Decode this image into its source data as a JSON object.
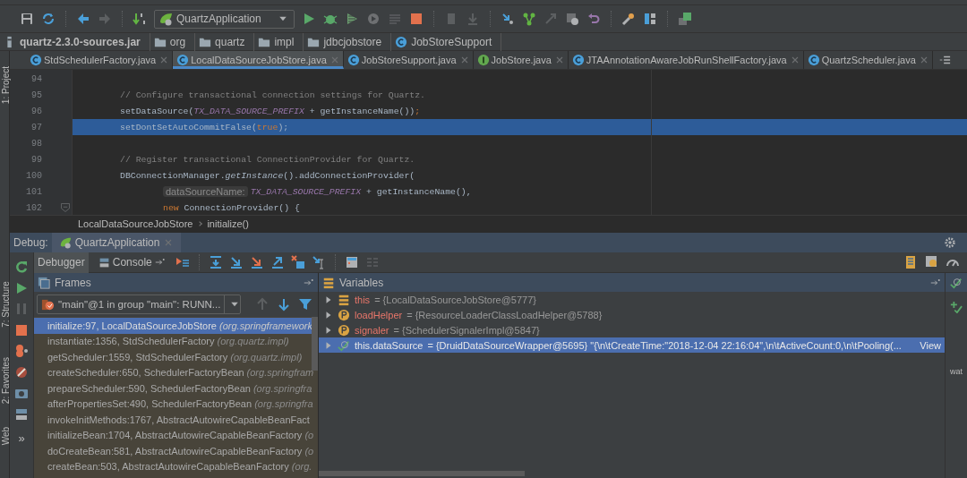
{
  "toolbar": {
    "run_config": "QuartzApplication"
  },
  "nav_bar": [
    "quartz-2.3.0-sources.jar",
    "org",
    "quartz",
    "impl",
    "jdbcjobstore",
    "JobStoreSupport"
  ],
  "side_labels": [
    "1: Project",
    "7: Structure",
    "2: Favorites",
    "Web"
  ],
  "tabs": [
    {
      "label": "StdSchedulerFactory.java",
      "selected": false,
      "kind": "class"
    },
    {
      "label": "LocalDataSourceJobStore.java",
      "selected": true,
      "kind": "class"
    },
    {
      "label": "JobStoreSupport.java",
      "selected": false,
      "kind": "class"
    },
    {
      "label": "JobStore.java",
      "selected": false,
      "kind": "interface"
    },
    {
      "label": "JTAAnnotationAwareJobRunShellFactory.java",
      "selected": false,
      "kind": "class"
    },
    {
      "label": "QuartzScheduler.java",
      "selected": false,
      "kind": "class"
    }
  ],
  "editor": {
    "lines": [
      {
        "number": "94",
        "current": false
      },
      {
        "number": "95",
        "current": false,
        "continuation": false,
        "segments": [
          {
            "kind": "comment",
            "text": "// Configure transactional connection settings for Quartz."
          }
        ]
      },
      {
        "number": "96",
        "current": false,
        "continuation": false,
        "segments": [
          {
            "kind": "plain",
            "text": "setDataSource("
          },
          {
            "kind": "constant",
            "text": "TX_DATA_SOURCE_PREFIX"
          },
          {
            "kind": "plain",
            "text": " + getInstanceName())"
          },
          {
            "kind": "keyword",
            "text": ";"
          }
        ]
      },
      {
        "number": "97",
        "current": true,
        "continuation": false,
        "segments": [
          {
            "kind": "plain",
            "text": "setDontSetAutoCommitFalse("
          },
          {
            "kind": "keyword",
            "text": "true"
          },
          {
            "kind": "plain",
            "text": ");"
          }
        ]
      },
      {
        "number": "98",
        "current": false
      },
      {
        "number": "99",
        "current": false,
        "continuation": false,
        "segments": [
          {
            "kind": "comment",
            "text": "// Register transactional ConnectionProvider for Quartz."
          }
        ]
      },
      {
        "number": "100",
        "current": false,
        "continuation": false,
        "segments": [
          {
            "kind": "plain",
            "text": "DBConnectionManager."
          },
          {
            "kind": "static",
            "text": "getInstance"
          },
          {
            "kind": "plain",
            "text": "().addConnectionProvider("
          }
        ]
      },
      {
        "number": "101",
        "current": false,
        "continuation": true,
        "segments": [
          {
            "kind": "hint",
            "text": "dataSourceName:"
          },
          {
            "kind": "constant",
            "text": "TX_DATA_SOURCE_PREFIX"
          },
          {
            "kind": "plain",
            "text": " + getInstanceName(),"
          }
        ]
      },
      {
        "number": "102",
        "current": false,
        "continuation": true,
        "segments": [
          {
            "kind": "keyword",
            "text": "new"
          },
          {
            "kind": "plain",
            "text": " ConnectionProvider() {"
          }
        ]
      }
    ],
    "breadcrumbs": [
      "LocalDataSourceJobStore",
      "initialize()"
    ]
  },
  "debug": {
    "label": "Debug:",
    "session_tab": "QuartzApplication",
    "tabs": [
      {
        "label": "Debugger",
        "selected": true
      },
      {
        "label": "Console",
        "selected": false
      }
    ],
    "more_label": "»",
    "frames": {
      "title": "Frames",
      "thread": "\"main\"@1 in group \"main\": RUNN...",
      "items": [
        {
          "method": "initialize:97, LocalDataSourceJobStore",
          "package": "(org.springframework",
          "selected": true
        },
        {
          "method": "instantiate:1356, StdSchedulerFactory",
          "package": "(org.quartz.impl)",
          "selected": false
        },
        {
          "method": "getScheduler:1559, StdSchedulerFactory",
          "package": "(org.quartz.impl)",
          "selected": false
        },
        {
          "method": "createScheduler:650, SchedulerFactoryBean",
          "package": "(org.springfram",
          "selected": false
        },
        {
          "method": "prepareScheduler:590, SchedulerFactoryBean",
          "package": "(org.springfra",
          "selected": false
        },
        {
          "method": "afterPropertiesSet:490, SchedulerFactoryBean",
          "package": "(org.springfra",
          "selected": false
        },
        {
          "method": "invokeInitMethods:1767, AbstractAutowireCapableBeanFact",
          "selected": false
        },
        {
          "method": "initializeBean:1704, AbstractAutowireCapableBeanFactory",
          "package": "(o",
          "selected": false
        },
        {
          "method": "doCreateBean:581, AbstractAutowireCapableBeanFactory",
          "package": "(o",
          "selected": false
        },
        {
          "method": "createBean:503, AbstractAutowireCapableBeanFactory",
          "package": "(org.",
          "selected": false
        }
      ]
    },
    "variables": {
      "title": "Variables",
      "items": [
        {
          "kind": "object",
          "name": "this",
          "value": "= {LocalDataSourceJobStore@5777}",
          "selected": false
        },
        {
          "kind": "field",
          "name": "loadHelper",
          "value": "= {ResourceLoaderClassLoadHelper@5788}",
          "selected": false
        },
        {
          "kind": "field",
          "name": "signaler",
          "value": "= {SchedulerSignalerImpl@5847}",
          "selected": false
        },
        {
          "kind": "watch",
          "name": "this.dataSource",
          "value": "= {DruidDataSourceWrapper@5695} \"{\\n\\tCreateTime:\"2018-12-04 22:16:04\",\\n\\tActiveCount:0,\\n\\tPooling(...",
          "link": "View",
          "selected": true
        }
      ]
    },
    "watches_label": "wat"
  }
}
